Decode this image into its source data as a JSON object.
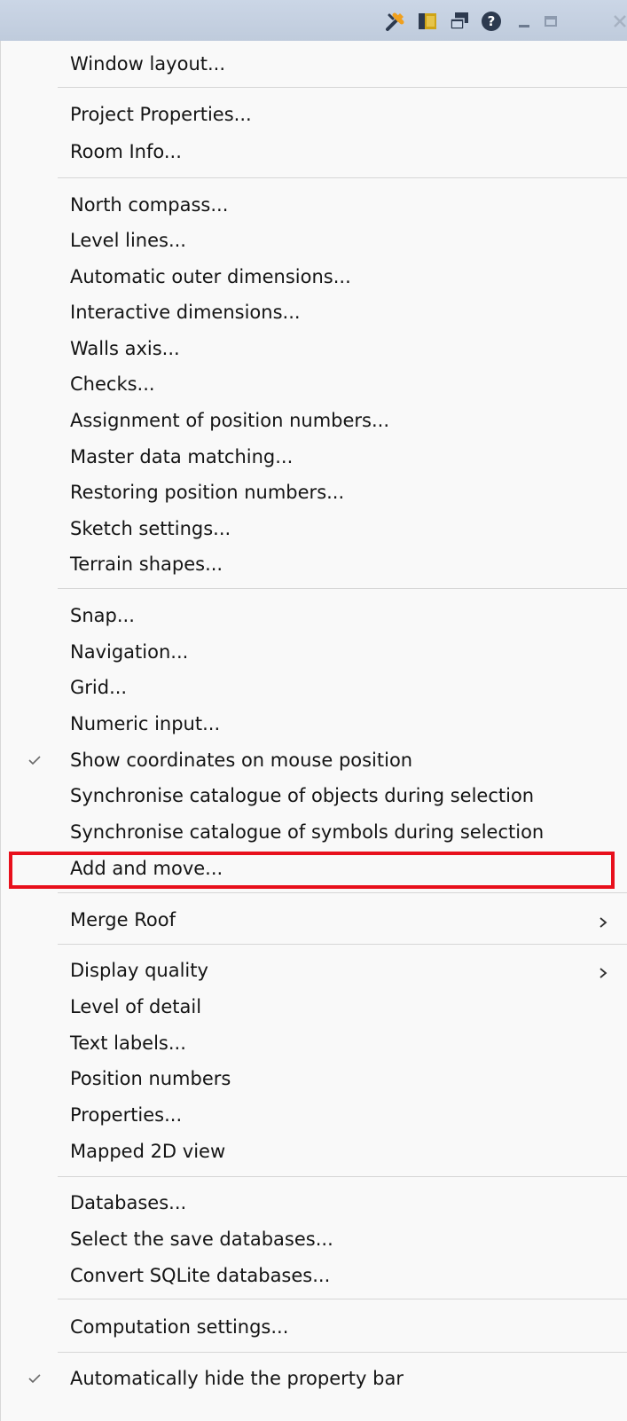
{
  "titlebar": {
    "icons": [
      "tools-icon",
      "panel-icon",
      "windows-icon",
      "help-icon",
      "minimize-icon",
      "restore-icon",
      "close-icon"
    ],
    "colors": {
      "tools": "#f0a01e",
      "accent": "#cfa416",
      "dark": "#2d3a4f"
    }
  },
  "menu": {
    "items": [
      {
        "label": "Window layout..."
      },
      {
        "label": "Project Properties..."
      },
      {
        "label": "Room Info..."
      },
      {
        "label": "North compass..."
      },
      {
        "label": "Level lines..."
      },
      {
        "label": "Automatic outer dimensions..."
      },
      {
        "label": "Interactive dimensions..."
      },
      {
        "label": "Walls axis..."
      },
      {
        "label": "Checks..."
      },
      {
        "label": "Assignment of position numbers..."
      },
      {
        "label": "Master data matching..."
      },
      {
        "label": "Restoring position numbers..."
      },
      {
        "label": "Sketch settings..."
      },
      {
        "label": "Terrain shapes..."
      },
      {
        "label": "Snap..."
      },
      {
        "label": "Navigation..."
      },
      {
        "label": "Grid..."
      },
      {
        "label": "Numeric input..."
      },
      {
        "label": "Show coordinates on mouse position",
        "checked": true
      },
      {
        "label": "Synchronise catalogue of objects during selection"
      },
      {
        "label": "Synchronise catalogue of symbols during selection"
      },
      {
        "label": "Add and move...",
        "highlighted": true
      },
      {
        "label": "Merge Roof",
        "submenu": true
      },
      {
        "label": "Display quality",
        "submenu": true
      },
      {
        "label": "Level of detail"
      },
      {
        "label": "Text labels..."
      },
      {
        "label": "Position numbers"
      },
      {
        "label": "Properties..."
      },
      {
        "label": "Mapped 2D view"
      },
      {
        "label": "Databases..."
      },
      {
        "label": "Select the save databases..."
      },
      {
        "label": "Convert SQLite databases..."
      },
      {
        "label": "Computation settings..."
      },
      {
        "label": "Automatically hide the property bar",
        "checked": true
      }
    ],
    "highlight_color": "#e8101c"
  }
}
